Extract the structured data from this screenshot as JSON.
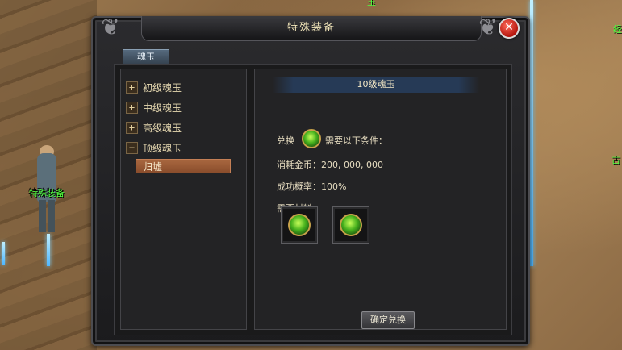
{
  "world": {
    "npc_label": "特殊装备",
    "edge_top": "玉",
    "edge_right": "经",
    "edge_right_2": "古"
  },
  "window": {
    "title": "特殊装备",
    "close_glyph": "✕"
  },
  "tab": {
    "label": "魂玉"
  },
  "tree": {
    "items": [
      {
        "label": "初级魂玉",
        "expander": "+"
      },
      {
        "label": "中级魂玉",
        "expander": "+"
      },
      {
        "label": "高级魂玉",
        "expander": "+"
      },
      {
        "label": "顶级魂玉",
        "expander": "−"
      }
    ],
    "selected_leaf": "归墟"
  },
  "detail": {
    "header": "10级魂玉",
    "exchange_prefix": "兑换",
    "exchange_suffix": "需要以下条件：",
    "gold_cost": "消耗金币：200, 000, 000",
    "success_rate": "成功概率：100%",
    "materials_label": "需要材料：",
    "confirm_button": "确定兑换"
  },
  "colors": {
    "accent_gold": "#f0e4b8",
    "selected_bg": "#a8673f",
    "npc_label": "#4dff3d"
  }
}
